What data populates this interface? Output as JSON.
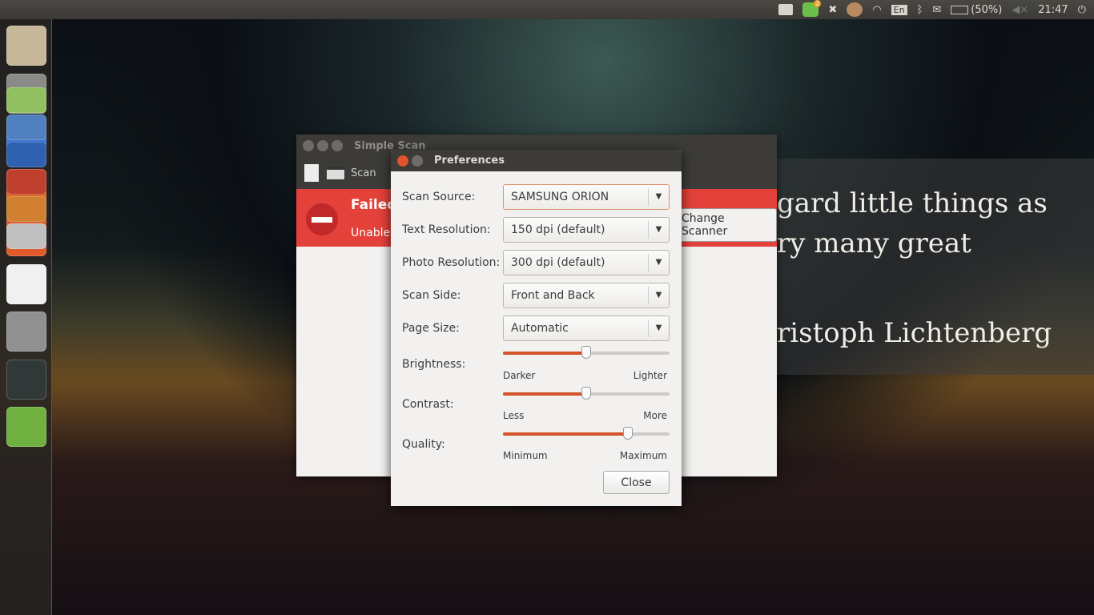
{
  "panel": {
    "keyboard": "En",
    "battery": "(50%)",
    "clock": "21:47",
    "badge": "2"
  },
  "launcher": [
    "ubuntu-dash",
    "files",
    "chrome",
    "firefox",
    "software-center",
    "libreoffice",
    "system-settings",
    "system-monitor",
    "games",
    "app-a",
    "app-b",
    "photoshop",
    "app-c",
    "app-d",
    "app-e"
  ],
  "quote": {
    "line1": "gard little things as",
    "line2": "ry many great",
    "line3": "ristoph Lichtenberg"
  },
  "simple_scan": {
    "title": "Simple Scan",
    "scan_label": "Scan",
    "error_title": "Failed",
    "error_text": "Unable",
    "change_scanner": "Change Scanner"
  },
  "prefs": {
    "title": "Preferences",
    "scan_source_label": "Scan Source:",
    "scan_source": "SAMSUNG ORION",
    "text_res_label": "Text Resolution:",
    "text_res": "150 dpi (default)",
    "photo_res_label": "Photo Resolution:",
    "photo_res": "300 dpi (default)",
    "scan_side_label": "Scan Side:",
    "scan_side": "Front and Back",
    "page_size_label": "Page Size:",
    "page_size": "Automatic",
    "brightness_label": "Brightness:",
    "brightness_min": "Darker",
    "brightness_max": "Lighter",
    "brightness_value": 50,
    "contrast_label": "Contrast:",
    "contrast_min": "Less",
    "contrast_max": "More",
    "contrast_value": 50,
    "quality_label": "Quality:",
    "quality_min": "Minimum",
    "quality_max": "Maximum",
    "quality_value": 75,
    "close": "Close"
  },
  "colors": {
    "accent": "#d4532b",
    "error": "#e3413a"
  }
}
